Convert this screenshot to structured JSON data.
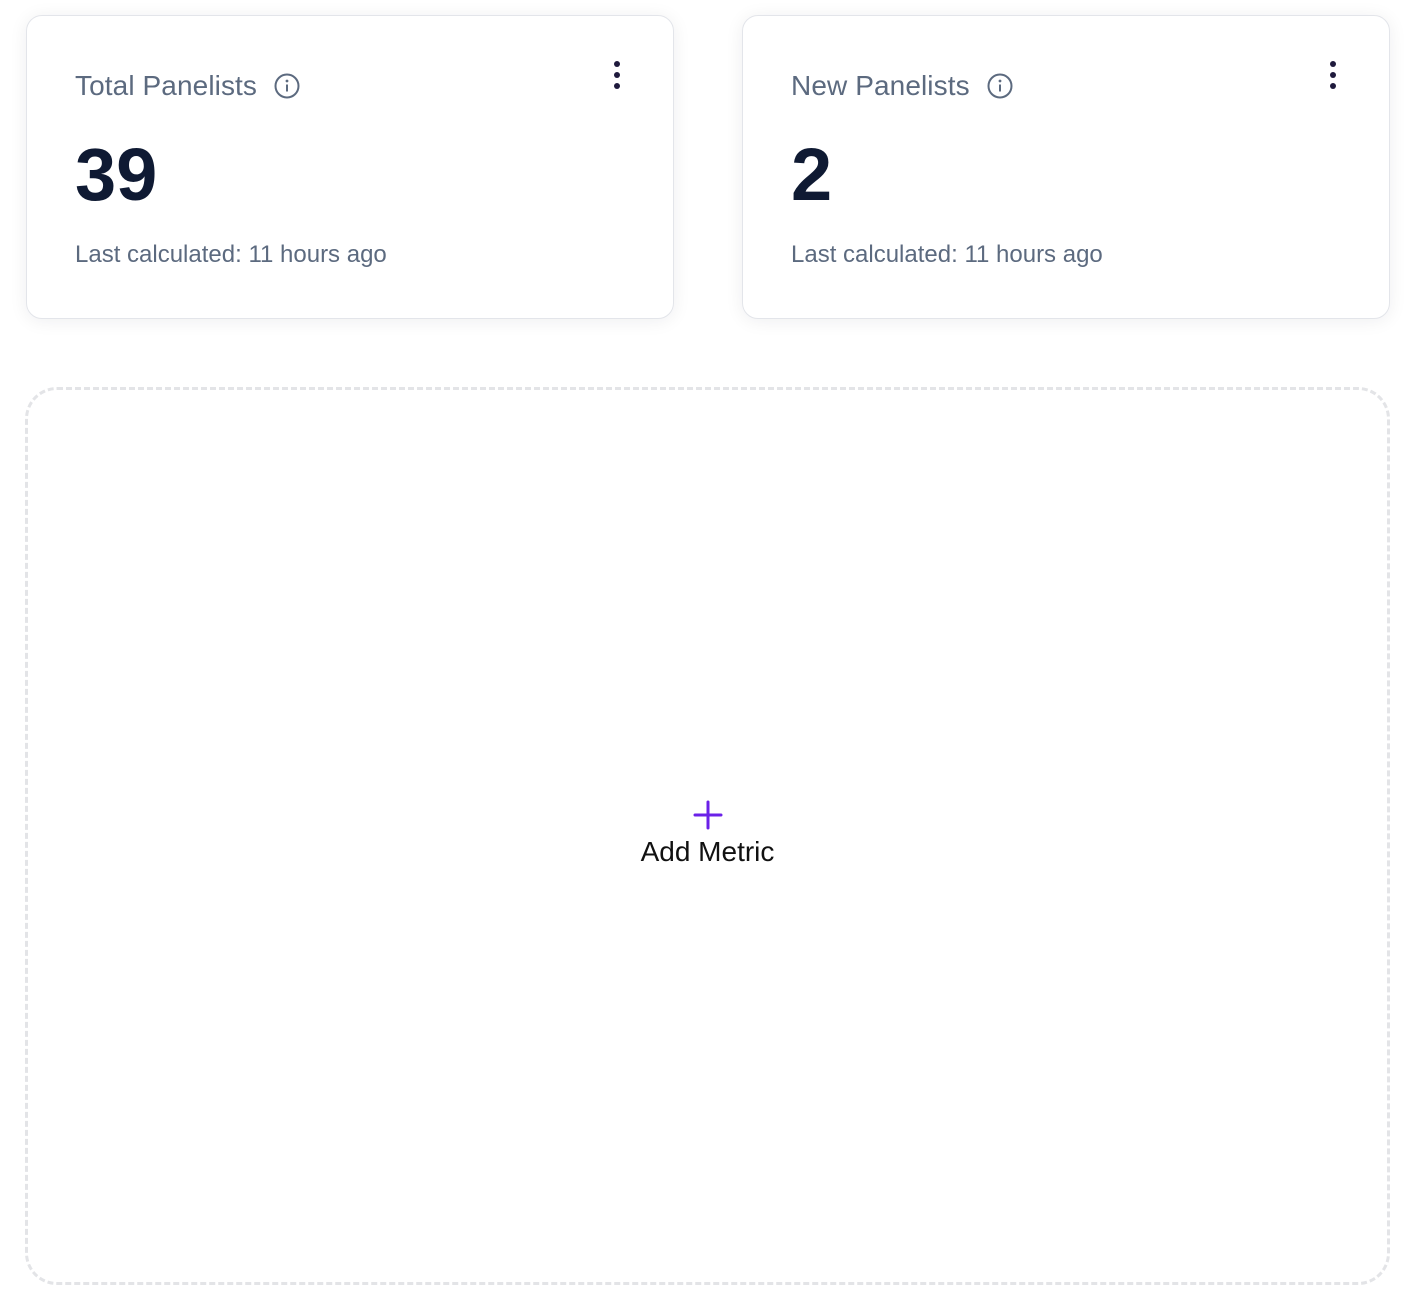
{
  "cards": [
    {
      "title": "Total Panelists",
      "value": "39",
      "footer": "Last calculated: 11 hours ago",
      "info_icon": "info-circle-icon",
      "menu_icon": "more-vertical-icon"
    },
    {
      "title": "New Panelists",
      "value": "2",
      "footer": "Last calculated: 11 hours ago",
      "info_icon": "info-circle-icon",
      "menu_icon": "more-vertical-icon"
    }
  ],
  "add_metric": {
    "label": "Add Metric",
    "icon": "plus-icon"
  },
  "colors": {
    "title_text": "#5c6a7f",
    "value_text": "#0f1a33",
    "accent": "#6b21e8",
    "kebab": "#1f1a3d",
    "dashed_border": "#e3e4e7"
  }
}
